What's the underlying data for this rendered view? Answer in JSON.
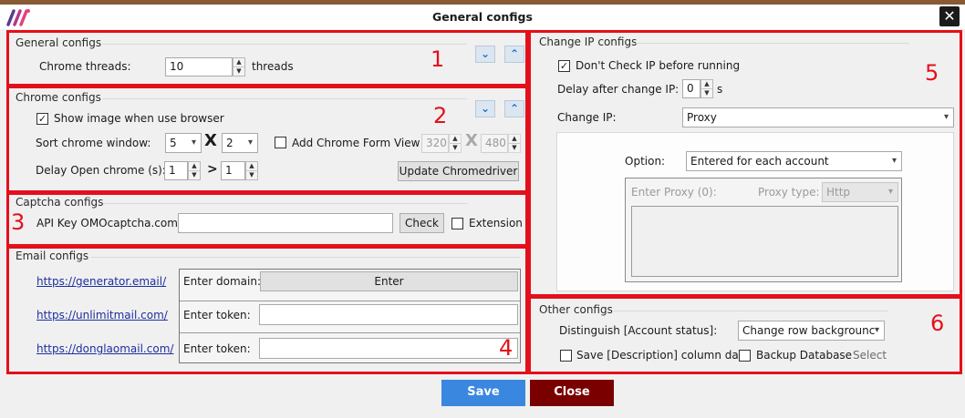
{
  "window": {
    "title": "General configs",
    "close_glyph": "✕"
  },
  "general": {
    "label": "General configs",
    "number": "1",
    "threads_label": "Chrome threads:",
    "threads_value": "10",
    "threads_unit": "threads"
  },
  "chrome": {
    "label": "Chrome configs",
    "number": "2",
    "show_image_label": "Show image when use browser",
    "show_image_checked": true,
    "sort_label": "Sort chrome window:",
    "sort_cols": "5",
    "sort_x": "X",
    "sort_rows": "2",
    "add_form_label": "Add Chrome Form View",
    "add_form_checked": false,
    "form_width": "320",
    "form_x": "X",
    "form_height": "480",
    "delay_label": "Delay Open chrome (s):",
    "delay_min": "1",
    "delay_gt": ">",
    "delay_max": "1",
    "update_button": "Update Chromedriver"
  },
  "captcha": {
    "label": "Captcha configs",
    "number": "3",
    "api_label": "API Key OMOcaptcha.com:",
    "api_value": "",
    "check_button": "Check",
    "extension_label": "Extension",
    "extension_checked": false
  },
  "email": {
    "label": "Email configs",
    "number": "4",
    "rows": [
      {
        "link": "https://generator.email/",
        "field_label": "Enter domain:",
        "button": "Enter"
      },
      {
        "link": "https://unlimitmail.com/",
        "field_label": "Enter token:",
        "value": ""
      },
      {
        "link": "https://donglaomail.com/",
        "field_label": "Enter token:",
        "value": ""
      }
    ]
  },
  "changeip": {
    "label": "Change IP configs",
    "number": "5",
    "dont_check_label": "Don't Check IP before running",
    "dont_check_checked": true,
    "delay_label": "Delay after change IP:",
    "delay_value": "0",
    "delay_unit": "s",
    "change_ip_label": "Change IP:",
    "change_ip_value": "Proxy",
    "option_label": "Option:",
    "option_value": "Entered for each account",
    "proxy_label": "Enter Proxy (0):",
    "proxy_type_label": "Proxy type:",
    "proxy_type_value": "Http"
  },
  "other": {
    "label": "Other configs",
    "number": "6",
    "distinguish_label": "Distinguish [Account status]:",
    "distinguish_value": "Change row backgrounc",
    "save_desc_label": "Save [Description] column data",
    "backup_label": "Backup Database",
    "select_label": "Select"
  },
  "footer": {
    "save": "Save",
    "close": "Close"
  },
  "icons": {
    "up": "chevron-up-icon",
    "down": "chevron-down-icon",
    "check": "checkmark-icon",
    "close": "close-icon",
    "logo": "app-logo-icon"
  },
  "colors": {
    "highlight": "#e3101b",
    "save": "#3a87e0",
    "close": "#7a0000",
    "link": "#1c2fa0"
  }
}
